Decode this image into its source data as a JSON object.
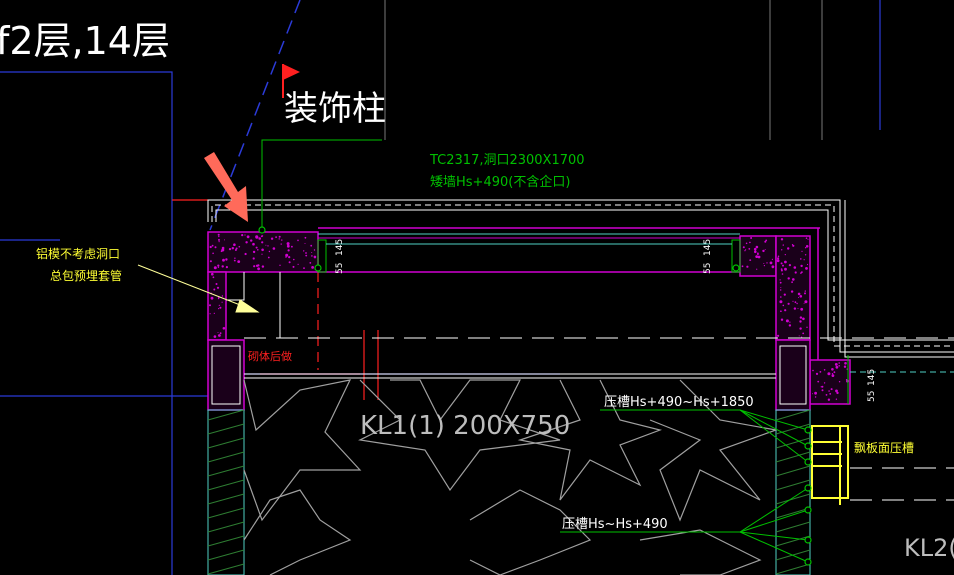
{
  "title_text": "f2层,14层",
  "callout": "装饰柱",
  "window": {
    "line1": "TC2317,洞口2300X1700",
    "line2": "矮墙Hs+490(不含企口)"
  },
  "note": {
    "line1": "铝模不考虑洞口",
    "line2": "总包预埋套管"
  },
  "masonry_note": "砌体后做",
  "beam_kl1": "KL1(1) 200X750",
  "beam_kl2": "KL2(",
  "press_top": "压槽Hs+490~Hs+1850",
  "press_bottom": "压槽Hs~Hs+490",
  "side_label": "飘板面压槽",
  "dims": {
    "d145a": "145",
    "d55a": "55",
    "d145b": "145",
    "d55b": "55",
    "d145c": "145",
    "d55c": "55"
  },
  "colors": {
    "background": "#000000",
    "magenta": "#d100d1",
    "green": "#00c000",
    "yellow": "#ffff33",
    "white": "#ffffff",
    "red": "#ff2020",
    "blue": "#2b3bd8",
    "cyan": "#4fd1c5",
    "arrow": "#ff6a5a"
  }
}
